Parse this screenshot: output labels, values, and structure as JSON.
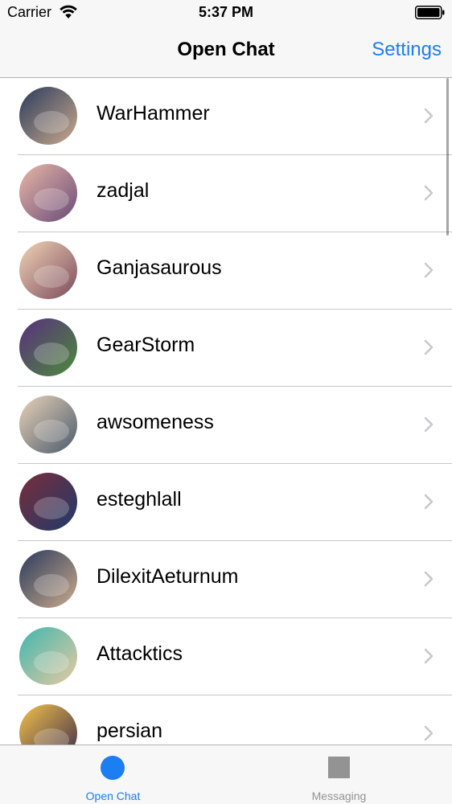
{
  "status_bar": {
    "carrier": "Carrier",
    "time": "5:37 PM",
    "icons": [
      "wifi-icon",
      "battery-icon"
    ]
  },
  "nav": {
    "title": "Open Chat",
    "settings_label": "Settings"
  },
  "chat_list": [
    {
      "name": "WarHammer",
      "avatar_colors": [
        "#2b3b5c",
        "#c9a98c"
      ]
    },
    {
      "name": "zadjal",
      "avatar_colors": [
        "#e8b8a6",
        "#6a4a7a"
      ]
    },
    {
      "name": "Ganjasaurous",
      "avatar_colors": [
        "#f1d4b6",
        "#7b4a5c"
      ]
    },
    {
      "name": "GearStorm",
      "avatar_colors": [
        "#5a2f7f",
        "#4c8a3a"
      ]
    },
    {
      "name": "awsomeness",
      "avatar_colors": [
        "#e9d3b8",
        "#4a5a6c"
      ]
    },
    {
      "name": "esteghlall",
      "avatar_colors": [
        "#7a2d3a",
        "#1f3a6a"
      ]
    },
    {
      "name": "DilexitAeturnum",
      "avatar_colors": [
        "#2b3b5c",
        "#c9a98c"
      ]
    },
    {
      "name": "Attacktics",
      "avatar_colors": [
        "#3fb7b0",
        "#e8c9a0"
      ]
    },
    {
      "name": "persian",
      "avatar_colors": [
        "#f4c34a",
        "#3a2a4a"
      ]
    }
  ],
  "tabs": [
    {
      "label": "Open Chat",
      "icon": "circle-icon",
      "selected": true
    },
    {
      "label": "Messaging",
      "icon": "square-icon",
      "selected": false
    }
  ],
  "colors": {
    "accent": "#1c7ef2",
    "inactive": "#939393",
    "separator": "#c8c7cc"
  }
}
